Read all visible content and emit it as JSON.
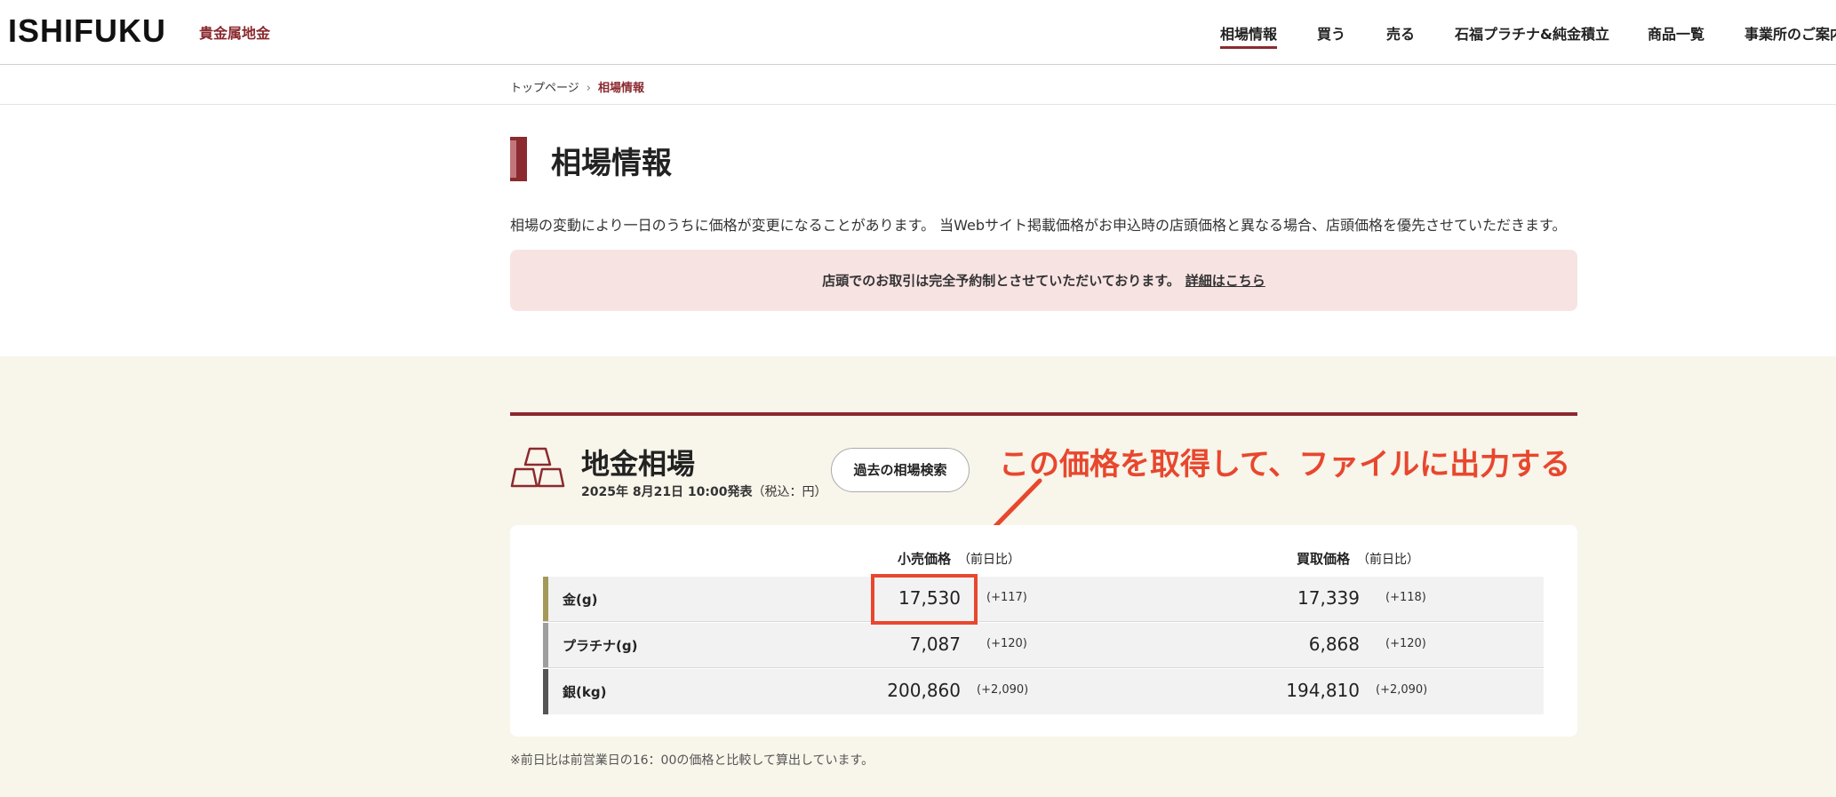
{
  "header": {
    "logo": "ISHIFUKU",
    "logo_sub": "貴金属地金",
    "nav": [
      "相場情報",
      "買う",
      "売る",
      "石福プラチナ&純金積立",
      "商品一覧",
      "事業所のご案内"
    ]
  },
  "breadcrumb": {
    "home": "トップページ",
    "current": "相場情報"
  },
  "page": {
    "title": "相場情報",
    "intro": "相場の変動により一日のうちに価格が変更になることがあります。 当Webサイト掲載価格がお申込時の店頭価格と異なる場合、店頭価格を優先させていただきます。",
    "notice_text": "店頭でのお取引は完全予約制とさせていただいております。",
    "notice_link": "詳細はこちら"
  },
  "market": {
    "title": "地金相場",
    "date": "2025年 8月21日 10:00発表",
    "tax_note": "（税込：円）",
    "history_button": "過去の相場検索",
    "annotation": "この価格を取得して、ファイルに出力する",
    "headers": {
      "retail": "小売価格",
      "buy": "買取価格",
      "change": "（前日比）"
    },
    "rows": [
      {
        "name": "金(g)",
        "retail": "17,530",
        "retail_change": "(+117)",
        "buy": "17,339",
        "buy_change": "(+118)",
        "color": "#a39a5a"
      },
      {
        "name": "プラチナ(g)",
        "retail": "7,087",
        "retail_change": "(+120)",
        "buy": "6,868",
        "buy_change": "(+120)",
        "color": "#9e9e9e"
      },
      {
        "name": "銀(kg)",
        "retail": "200,860",
        "retail_change": "(+2,090)",
        "buy": "194,810",
        "buy_change": "(+2,090)",
        "color": "#555555"
      }
    ],
    "footnote": "※前日比は前営業日の16：00の価格と比較して算出しています。"
  },
  "colors": {
    "accent": "#8b2a2f",
    "annotation": "#e8472e",
    "notice_bg": "#f8e3e3",
    "market_bg": "#f8f5ea"
  }
}
